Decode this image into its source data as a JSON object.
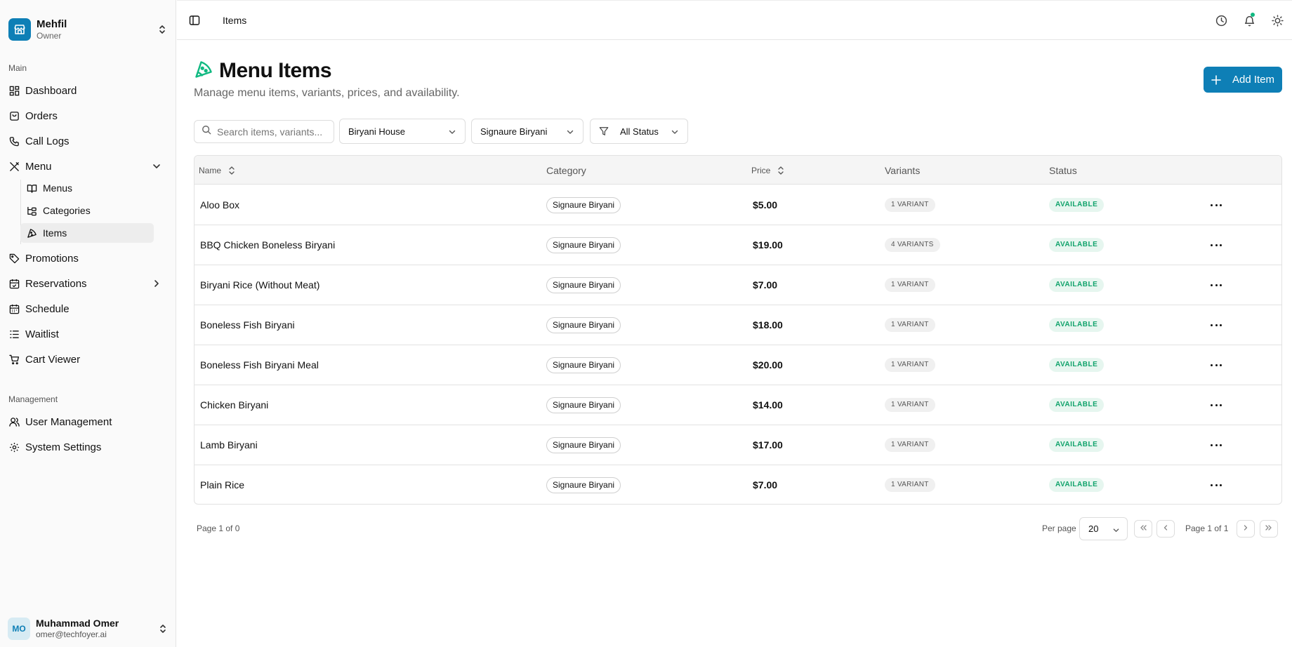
{
  "org": {
    "name": "Mehfil",
    "role": "Owner"
  },
  "sidebar": {
    "main_label": "Main",
    "items": [
      {
        "label": "Dashboard"
      },
      {
        "label": "Orders"
      },
      {
        "label": "Call Logs"
      },
      {
        "label": "Menu"
      },
      {
        "label": "Promotions"
      },
      {
        "label": "Reservations"
      },
      {
        "label": "Schedule"
      },
      {
        "label": "Waitlist"
      },
      {
        "label": "Cart Viewer"
      }
    ],
    "menu_sub": [
      {
        "label": "Menus"
      },
      {
        "label": "Categories"
      },
      {
        "label": "Items",
        "active": true
      }
    ],
    "management_label": "Management",
    "management_items": [
      {
        "label": "User Management"
      },
      {
        "label": "System Settings"
      }
    ]
  },
  "user": {
    "initials": "MO",
    "name": "Muhammad Omer",
    "email": "omer@techfoyer.ai"
  },
  "topbar": {
    "breadcrumb": "Items"
  },
  "page": {
    "title": "Menu Items",
    "subtitle": "Manage menu items, variants, prices, and availability.",
    "add_button": "Add Item"
  },
  "filters": {
    "search_placeholder": "Search items, variants...",
    "restaurant": "Biryani House",
    "category": "Signaure Biryani",
    "status": "All Status"
  },
  "table": {
    "columns": {
      "name": "Name",
      "category": "Category",
      "price": "Price",
      "variants": "Variants",
      "status": "Status"
    },
    "rows": [
      {
        "name": "Aloo Box",
        "category": "Signaure Biryani",
        "price": "$5.00",
        "variants": "1 VARIANT",
        "status": "AVAILABLE"
      },
      {
        "name": "BBQ Chicken Boneless Biryani",
        "category": "Signaure Biryani",
        "price": "$19.00",
        "variants": "4 VARIANTS",
        "status": "AVAILABLE"
      },
      {
        "name": "Biryani Rice (Without Meat)",
        "category": "Signaure Biryani",
        "price": "$7.00",
        "variants": "1 VARIANT",
        "status": "AVAILABLE"
      },
      {
        "name": "Boneless Fish Biryani",
        "category": "Signaure Biryani",
        "price": "$18.00",
        "variants": "1 VARIANT",
        "status": "AVAILABLE"
      },
      {
        "name": "Boneless Fish Biryani Meal",
        "category": "Signaure Biryani",
        "price": "$20.00",
        "variants": "1 VARIANT",
        "status": "AVAILABLE"
      },
      {
        "name": "Chicken Biryani",
        "category": "Signaure Biryani",
        "price": "$14.00",
        "variants": "1 VARIANT",
        "status": "AVAILABLE"
      },
      {
        "name": "Lamb Biryani",
        "category": "Signaure Biryani",
        "price": "$17.00",
        "variants": "1 VARIANT",
        "status": "AVAILABLE"
      },
      {
        "name": "Plain Rice",
        "category": "Signaure Biryani",
        "price": "$7.00",
        "variants": "1 VARIANT",
        "status": "AVAILABLE"
      }
    ]
  },
  "footer": {
    "left": "Page 1 of 0",
    "per_page_label": "Per page",
    "per_page_value": "20",
    "page_text": "Page 1 of 1"
  },
  "colors": {
    "brand": "#0e7fb6",
    "available": "#10a36b",
    "accent_icon": "#10b981"
  }
}
